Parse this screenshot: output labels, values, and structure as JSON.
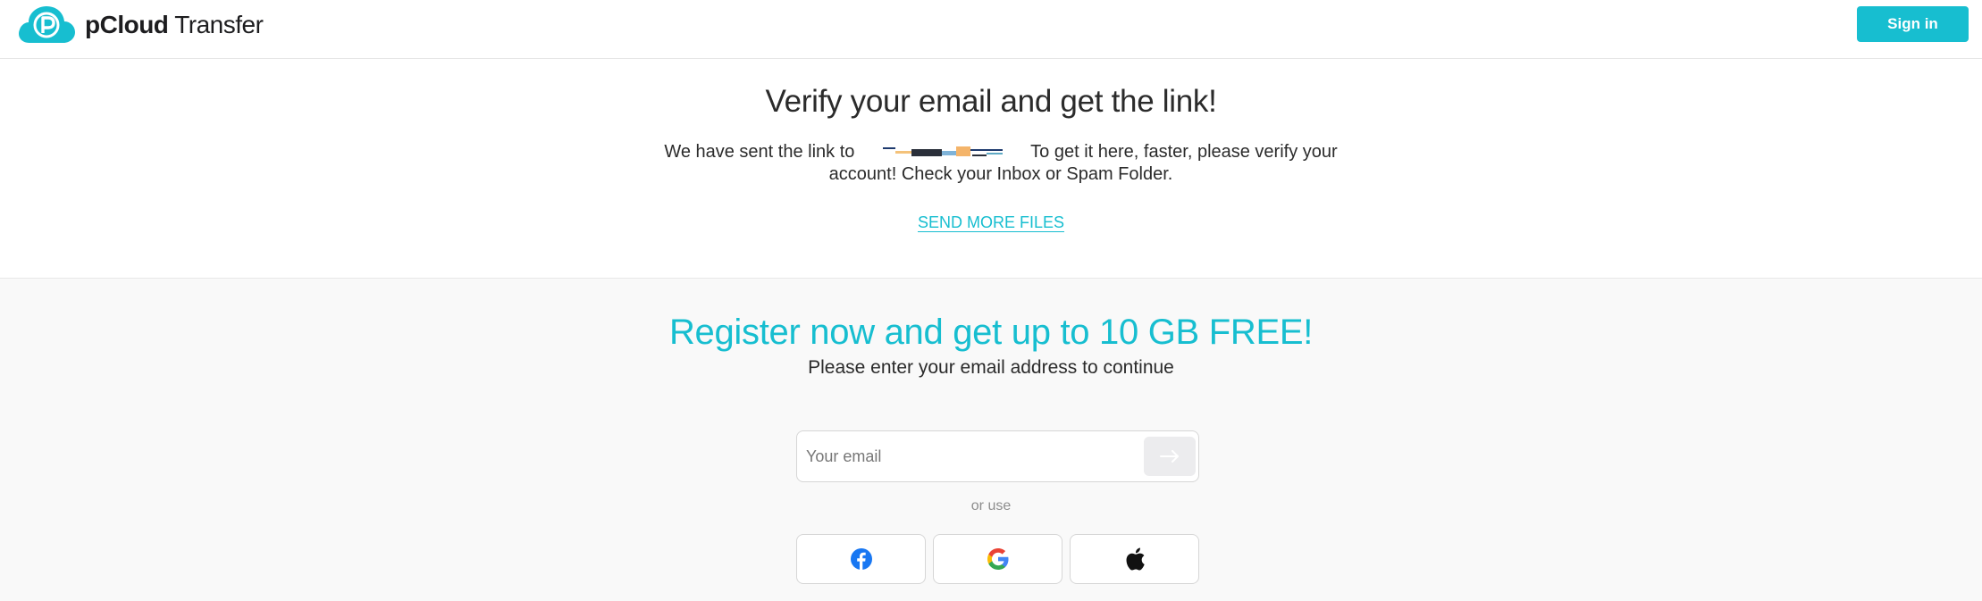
{
  "header": {
    "brand_bold": "pCloud",
    "brand_light": "Transfer",
    "signin_label": "Sign in"
  },
  "verify": {
    "title": "Verify your email and get the link!",
    "text_before": "We have sent the link to",
    "text_after": "To get it here, faster, please verify your account! Check your Inbox or Spam Folder.",
    "send_more_label": "SEND MORE FILES"
  },
  "register": {
    "title": "Register now and get up to 10 GB FREE!",
    "subtitle": "Please enter your email address to continue",
    "email_placeholder": "Your email",
    "or_use": "or use",
    "social": [
      "facebook-icon",
      "google-icon",
      "apple-icon"
    ]
  },
  "colors": {
    "accent": "#17bed0",
    "text": "#2b2b2b",
    "muted": "#8d8d8d",
    "panel_bg": "#f9f9f9"
  }
}
